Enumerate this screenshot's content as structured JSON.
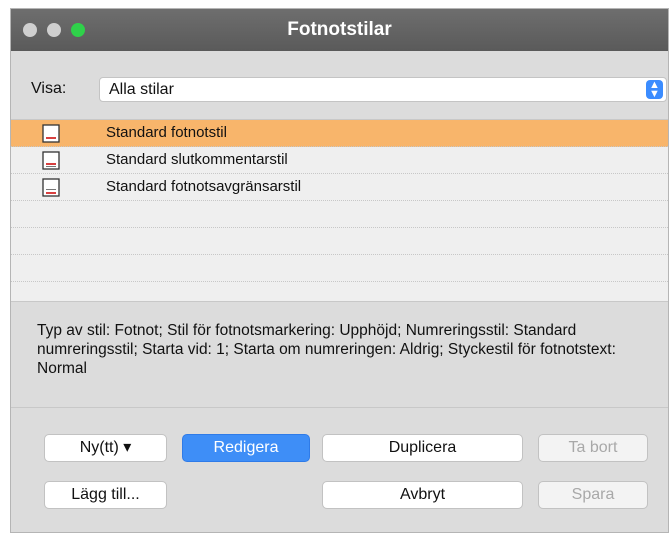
{
  "window": {
    "title": "Fotnotstilar"
  },
  "filter": {
    "label": "Visa:",
    "selected": "Alla stilar"
  },
  "styles": [
    {
      "label": "Standard fotnotstil",
      "selected": true
    },
    {
      "label": "Standard slutkommentarstil",
      "selected": false
    },
    {
      "label": "Standard fotnotsavgränsarstil",
      "selected": false
    }
  ],
  "description": "Typ av stil: Fotnot;  Stil för fotnotsmarkering: Upphöjd; Numreringsstil: Standard numreringsstil;  Starta vid: 1;  Starta om numreringen: Aldrig;  Styckestil för fotnotstext: Normal",
  "buttons": {
    "new": "Ny(tt) ▾",
    "edit": "Redigera",
    "duplicate": "Duplicera",
    "delete": "Ta bort",
    "add": "Lägg till...",
    "cancel": "Avbryt",
    "save": "Spara"
  },
  "colors": {
    "selection": "#f8b56b",
    "accent": "#3e8ef7"
  },
  "icons": {
    "close": "close-icon",
    "minimize": "minimize-icon",
    "zoom": "zoom-icon",
    "dropdown": "chevron-updown-icon",
    "style_doc": "document-icon"
  }
}
